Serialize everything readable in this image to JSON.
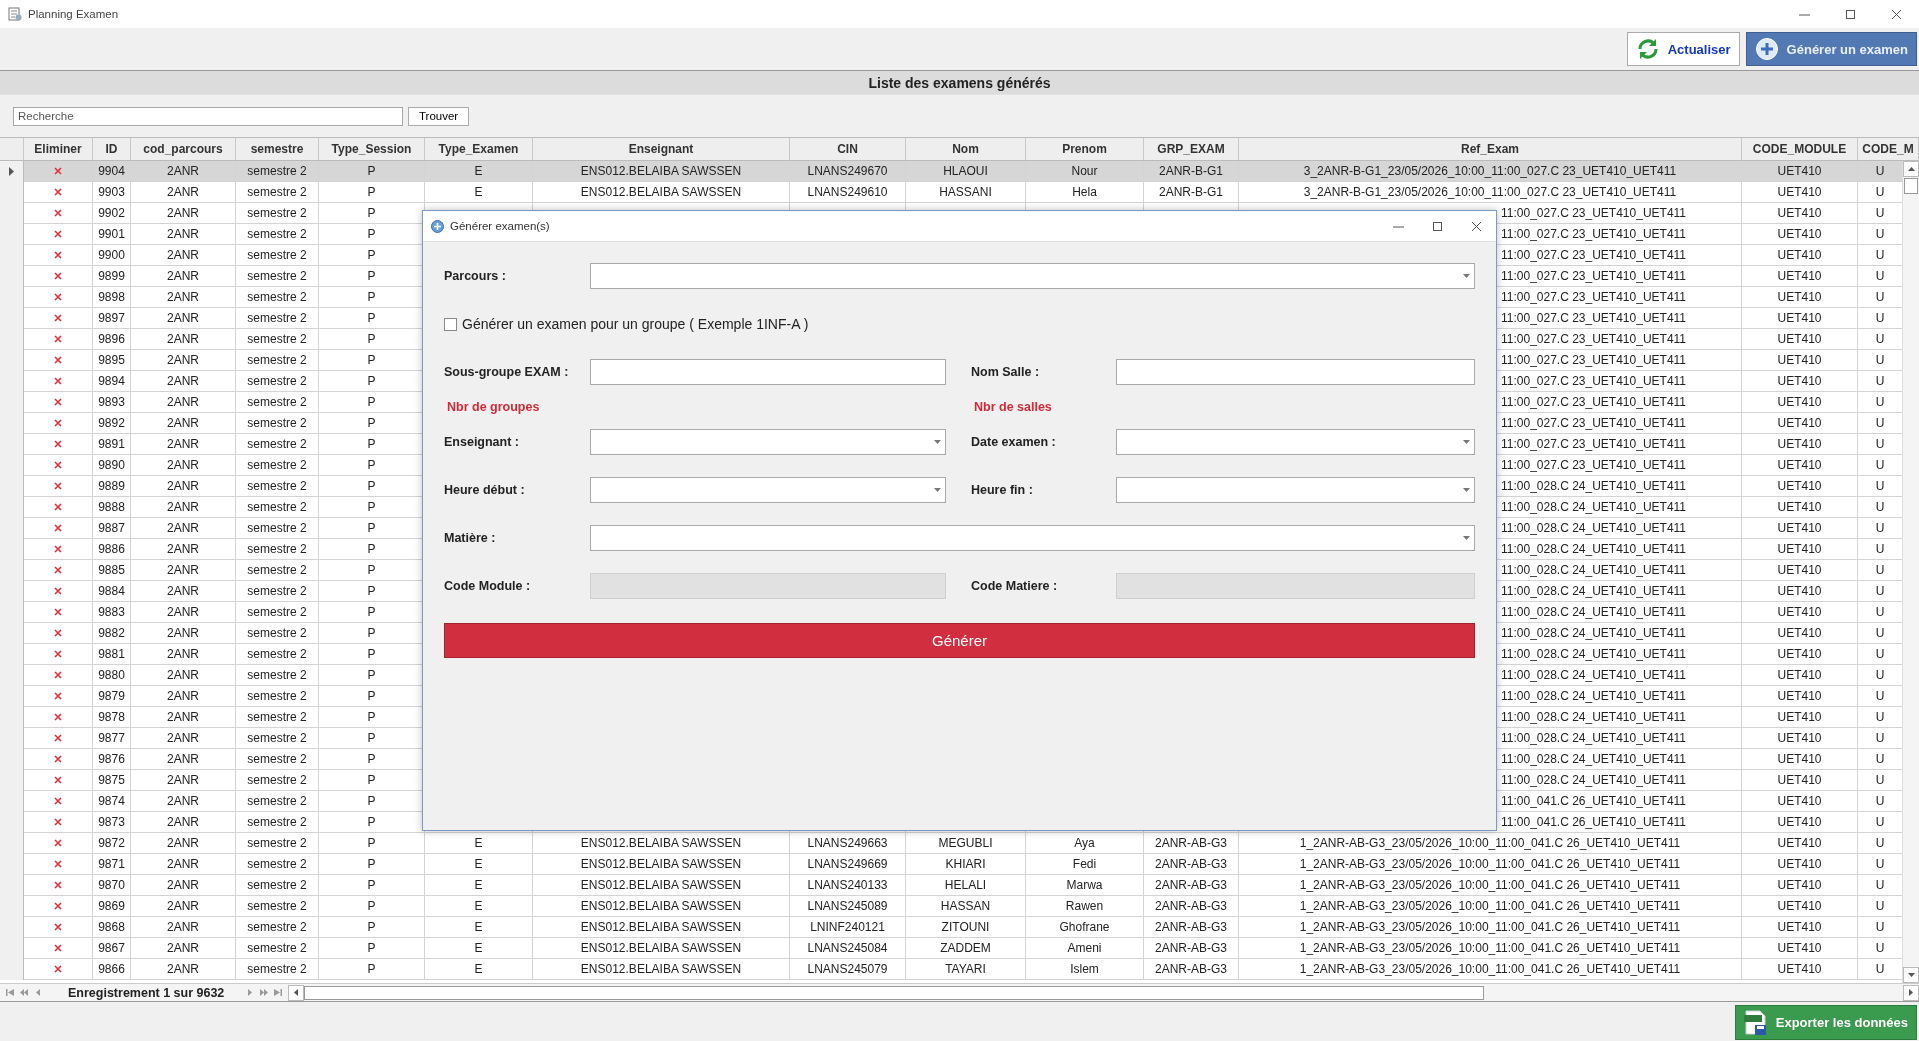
{
  "window": {
    "title": "Planning Examen"
  },
  "toolbar": [
    {
      "label": "Actualiser",
      "kind": "refresh"
    },
    {
      "label": "Générer un examen",
      "kind": "add"
    }
  ],
  "panel_title": "Liste des examens générés",
  "search": {
    "placeholder": "Recherche",
    "button": "Trouver"
  },
  "table": {
    "columns": [
      "Eliminer",
      "ID",
      "cod_parcours",
      "semestre",
      "Type_Session",
      "Type_Examen",
      "Enseignant",
      "CIN",
      "Nom",
      "Prenom",
      "GRP_EXAM",
      "Ref_Exam",
      "CODE_MODULE",
      "CODE_M"
    ],
    "rows": [
      {
        "id": "9904",
        "cod_parcours": "2ANR",
        "semestre": "semestre 2",
        "type_session": "P",
        "type_examen": "E",
        "enseignant": "ENS012.BELAIBA SAWSSEN",
        "cin": "LNANS249670",
        "nom": "HLAOUI",
        "prenom": "Nour",
        "grp_exam": "2ANR-B-G1",
        "ref_exam": "3_2ANR-B-G1_23/05/2026_10:00_11:00_027.C 23_UET410_UET411",
        "code_module": "UET410",
        "code_m": "U",
        "selected": true,
        "covered": false
      },
      {
        "id": "9903",
        "cod_parcours": "2ANR",
        "semestre": "semestre 2",
        "type_session": "P",
        "type_examen": "E",
        "enseignant": "ENS012.BELAIBA SAWSSEN",
        "cin": "LNANS249610",
        "nom": "HASSANI",
        "prenom": "Hela",
        "grp_exam": "2ANR-B-G1",
        "ref_exam": "3_2ANR-B-G1_23/05/2026_10:00_11:00_027.C 23_UET410_UET411",
        "code_module": "UET410",
        "code_m": "U",
        "selected": false,
        "covered": false
      },
      {
        "id": "9902",
        "cod_parcours": "2ANR",
        "semestre": "semestre 2",
        "type_session": "P",
        "ref_exam": "11:00_027.C 23_UET410_UET411",
        "code_module": "UET410",
        "code_m": "U",
        "selected": false,
        "covered": true
      },
      {
        "id": "9901",
        "cod_parcours": "2ANR",
        "semestre": "semestre 2",
        "type_session": "P",
        "ref_exam": "11:00_027.C 23_UET410_UET411",
        "code_module": "UET410",
        "code_m": "U",
        "selected": false,
        "covered": true
      },
      {
        "id": "9900",
        "cod_parcours": "2ANR",
        "semestre": "semestre 2",
        "type_session": "P",
        "ref_exam": "11:00_027.C 23_UET410_UET411",
        "code_module": "UET410",
        "code_m": "U",
        "selected": false,
        "covered": true
      },
      {
        "id": "9899",
        "cod_parcours": "2ANR",
        "semestre": "semestre 2",
        "type_session": "P",
        "ref_exam": "11:00_027.C 23_UET410_UET411",
        "code_module": "UET410",
        "code_m": "U",
        "selected": false,
        "covered": true
      },
      {
        "id": "9898",
        "cod_parcours": "2ANR",
        "semestre": "semestre 2",
        "type_session": "P",
        "ref_exam": "11:00_027.C 23_UET410_UET411",
        "code_module": "UET410",
        "code_m": "U",
        "selected": false,
        "covered": true
      },
      {
        "id": "9897",
        "cod_parcours": "2ANR",
        "semestre": "semestre 2",
        "type_session": "P",
        "ref_exam": "11:00_027.C 23_UET410_UET411",
        "code_module": "UET410",
        "code_m": "U",
        "selected": false,
        "covered": true
      },
      {
        "id": "9896",
        "cod_parcours": "2ANR",
        "semestre": "semestre 2",
        "type_session": "P",
        "ref_exam": "11:00_027.C 23_UET410_UET411",
        "code_module": "UET410",
        "code_m": "U",
        "selected": false,
        "covered": true
      },
      {
        "id": "9895",
        "cod_parcours": "2ANR",
        "semestre": "semestre 2",
        "type_session": "P",
        "ref_exam": "11:00_027.C 23_UET410_UET411",
        "code_module": "UET410",
        "code_m": "U",
        "selected": false,
        "covered": true
      },
      {
        "id": "9894",
        "cod_parcours": "2ANR",
        "semestre": "semestre 2",
        "type_session": "P",
        "ref_exam": "11:00_027.C 23_UET410_UET411",
        "code_module": "UET410",
        "code_m": "U",
        "selected": false,
        "covered": true
      },
      {
        "id": "9893",
        "cod_parcours": "2ANR",
        "semestre": "semestre 2",
        "type_session": "P",
        "ref_exam": "11:00_027.C 23_UET410_UET411",
        "code_module": "UET410",
        "code_m": "U",
        "selected": false,
        "covered": true
      },
      {
        "id": "9892",
        "cod_parcours": "2ANR",
        "semestre": "semestre 2",
        "type_session": "P",
        "ref_exam": "11:00_027.C 23_UET410_UET411",
        "code_module": "UET410",
        "code_m": "U",
        "selected": false,
        "covered": true
      },
      {
        "id": "9891",
        "cod_parcours": "2ANR",
        "semestre": "semestre 2",
        "type_session": "P",
        "ref_exam": "11:00_027.C 23_UET410_UET411",
        "code_module": "UET410",
        "code_m": "U",
        "selected": false,
        "covered": true
      },
      {
        "id": "9890",
        "cod_parcours": "2ANR",
        "semestre": "semestre 2",
        "type_session": "P",
        "ref_exam": "11:00_027.C 23_UET410_UET411",
        "code_module": "UET410",
        "code_m": "U",
        "selected": false,
        "covered": true
      },
      {
        "id": "9889",
        "cod_parcours": "2ANR",
        "semestre": "semestre 2",
        "type_session": "P",
        "ref_exam": "11:00_028.C 24_UET410_UET411",
        "code_module": "UET410",
        "code_m": "U",
        "selected": false,
        "covered": true
      },
      {
        "id": "9888",
        "cod_parcours": "2ANR",
        "semestre": "semestre 2",
        "type_session": "P",
        "ref_exam": "11:00_028.C 24_UET410_UET411",
        "code_module": "UET410",
        "code_m": "U",
        "selected": false,
        "covered": true
      },
      {
        "id": "9887",
        "cod_parcours": "2ANR",
        "semestre": "semestre 2",
        "type_session": "P",
        "ref_exam": "11:00_028.C 24_UET410_UET411",
        "code_module": "UET410",
        "code_m": "U",
        "selected": false,
        "covered": true
      },
      {
        "id": "9886",
        "cod_parcours": "2ANR",
        "semestre": "semestre 2",
        "type_session": "P",
        "ref_exam": "11:00_028.C 24_UET410_UET411",
        "code_module": "UET410",
        "code_m": "U",
        "selected": false,
        "covered": true
      },
      {
        "id": "9885",
        "cod_parcours": "2ANR",
        "semestre": "semestre 2",
        "type_session": "P",
        "ref_exam": "11:00_028.C 24_UET410_UET411",
        "code_module": "UET410",
        "code_m": "U",
        "selected": false,
        "covered": true
      },
      {
        "id": "9884",
        "cod_parcours": "2ANR",
        "semestre": "semestre 2",
        "type_session": "P",
        "ref_exam": "11:00_028.C 24_UET410_UET411",
        "code_module": "UET410",
        "code_m": "U",
        "selected": false,
        "covered": true
      },
      {
        "id": "9883",
        "cod_parcours": "2ANR",
        "semestre": "semestre 2",
        "type_session": "P",
        "ref_exam": "11:00_028.C 24_UET410_UET411",
        "code_module": "UET410",
        "code_m": "U",
        "selected": false,
        "covered": true
      },
      {
        "id": "9882",
        "cod_parcours": "2ANR",
        "semestre": "semestre 2",
        "type_session": "P",
        "ref_exam": "11:00_028.C 24_UET410_UET411",
        "code_module": "UET410",
        "code_m": "U",
        "selected": false,
        "covered": true
      },
      {
        "id": "9881",
        "cod_parcours": "2ANR",
        "semestre": "semestre 2",
        "type_session": "P",
        "ref_exam": "11:00_028.C 24_UET410_UET411",
        "code_module": "UET410",
        "code_m": "U",
        "selected": false,
        "covered": true
      },
      {
        "id": "9880",
        "cod_parcours": "2ANR",
        "semestre": "semestre 2",
        "type_session": "P",
        "ref_exam": "11:00_028.C 24_UET410_UET411",
        "code_module": "UET410",
        "code_m": "U",
        "selected": false,
        "covered": true
      },
      {
        "id": "9879",
        "cod_parcours": "2ANR",
        "semestre": "semestre 2",
        "type_session": "P",
        "ref_exam": "11:00_028.C 24_UET410_UET411",
        "code_module": "UET410",
        "code_m": "U",
        "selected": false,
        "covered": true
      },
      {
        "id": "9878",
        "cod_parcours": "2ANR",
        "semestre": "semestre 2",
        "type_session": "P",
        "ref_exam": "11:00_028.C 24_UET410_UET411",
        "code_module": "UET410",
        "code_m": "U",
        "selected": false,
        "covered": true
      },
      {
        "id": "9877",
        "cod_parcours": "2ANR",
        "semestre": "semestre 2",
        "type_session": "P",
        "ref_exam": "11:00_028.C 24_UET410_UET411",
        "code_module": "UET410",
        "code_m": "U",
        "selected": false,
        "covered": true
      },
      {
        "id": "9876",
        "cod_parcours": "2ANR",
        "semestre": "semestre 2",
        "type_session": "P",
        "ref_exam": "11:00_028.C 24_UET410_UET411",
        "code_module": "UET410",
        "code_m": "U",
        "selected": false,
        "covered": true
      },
      {
        "id": "9875",
        "cod_parcours": "2ANR",
        "semestre": "semestre 2",
        "type_session": "P",
        "ref_exam": "11:00_028.C 24_UET410_UET411",
        "code_module": "UET410",
        "code_m": "U",
        "selected": false,
        "covered": true
      },
      {
        "id": "9874",
        "cod_parcours": "2ANR",
        "semestre": "semestre 2",
        "type_session": "P",
        "ref_exam": "11:00_041.C 26_UET410_UET411",
        "code_module": "UET410",
        "code_m": "U",
        "selected": false,
        "covered": true
      },
      {
        "id": "9873",
        "cod_parcours": "2ANR",
        "semestre": "semestre 2",
        "type_session": "P",
        "ref_exam": "11:00_041.C 26_UET410_UET411",
        "code_module": "UET410",
        "code_m": "U",
        "selected": false,
        "covered": true
      },
      {
        "id": "9872",
        "cod_parcours": "2ANR",
        "semestre": "semestre 2",
        "type_session": "P",
        "type_examen": "E",
        "enseignant": "ENS012.BELAIBA SAWSSEN",
        "cin": "LNANS249663",
        "nom": "MEGUBLI",
        "prenom": "Aya",
        "grp_exam": "2ANR-AB-G3",
        "ref_exam": "1_2ANR-AB-G3_23/05/2026_10:00_11:00_041.C 26_UET410_UET411",
        "code_module": "UET410",
        "code_m": "U",
        "selected": false,
        "covered": false
      },
      {
        "id": "9871",
        "cod_parcours": "2ANR",
        "semestre": "semestre 2",
        "type_session": "P",
        "type_examen": "E",
        "enseignant": "ENS012.BELAIBA SAWSSEN",
        "cin": "LNANS249669",
        "nom": "KHIARI",
        "prenom": "Fedi",
        "grp_exam": "2ANR-AB-G3",
        "ref_exam": "1_2ANR-AB-G3_23/05/2026_10:00_11:00_041.C 26_UET410_UET411",
        "code_module": "UET410",
        "code_m": "U",
        "selected": false,
        "covered": false
      },
      {
        "id": "9870",
        "cod_parcours": "2ANR",
        "semestre": "semestre 2",
        "type_session": "P",
        "type_examen": "E",
        "enseignant": "ENS012.BELAIBA SAWSSEN",
        "cin": "LNANS240133",
        "nom": "HELALI",
        "prenom": "Marwa",
        "grp_exam": "2ANR-AB-G3",
        "ref_exam": "1_2ANR-AB-G3_23/05/2026_10:00_11:00_041.C 26_UET410_UET411",
        "code_module": "UET410",
        "code_m": "U",
        "selected": false,
        "covered": false
      },
      {
        "id": "9869",
        "cod_parcours": "2ANR",
        "semestre": "semestre 2",
        "type_session": "P",
        "type_examen": "E",
        "enseignant": "ENS012.BELAIBA SAWSSEN",
        "cin": "LNANS245089",
        "nom": "HASSAN",
        "prenom": "Rawen",
        "grp_exam": "2ANR-AB-G3",
        "ref_exam": "1_2ANR-AB-G3_23/05/2026_10:00_11:00_041.C 26_UET410_UET411",
        "code_module": "UET410",
        "code_m": "U",
        "selected": false,
        "covered": false
      },
      {
        "id": "9868",
        "cod_parcours": "2ANR",
        "semestre": "semestre 2",
        "type_session": "P",
        "type_examen": "E",
        "enseignant": "ENS012.BELAIBA SAWSSEN",
        "cin": "LNINF240121",
        "nom": "ZITOUNI",
        "prenom": "Ghofrane",
        "grp_exam": "2ANR-AB-G3",
        "ref_exam": "1_2ANR-AB-G3_23/05/2026_10:00_11:00_041.C 26_UET410_UET411",
        "code_module": "UET410",
        "code_m": "U",
        "selected": false,
        "covered": false
      },
      {
        "id": "9867",
        "cod_parcours": "2ANR",
        "semestre": "semestre 2",
        "type_session": "P",
        "type_examen": "E",
        "enseignant": "ENS012.BELAIBA SAWSSEN",
        "cin": "LNANS245084",
        "nom": "ZADDEM",
        "prenom": "Ameni",
        "grp_exam": "2ANR-AB-G3",
        "ref_exam": "1_2ANR-AB-G3_23/05/2026_10:00_11:00_041.C 26_UET410_UET411",
        "code_module": "UET410",
        "code_m": "U",
        "selected": false,
        "covered": false
      },
      {
        "id": "9866",
        "cod_parcours": "2ANR",
        "semestre": "semestre 2",
        "type_session": "P",
        "type_examen": "E",
        "enseignant": "ENS012.BELAIBA SAWSSEN",
        "cin": "LNANS245079",
        "nom": "TAYARI",
        "prenom": "Islem",
        "grp_exam": "2ANR-AB-G3",
        "ref_exam": "1_2ANR-AB-G3_23/05/2026_10:00_11:00_041.C 26_UET410_UET411",
        "code_module": "UET410",
        "code_m": "U",
        "selected": false,
        "covered": false
      }
    ]
  },
  "pager": {
    "text": "Enregistrement 1 sur 9632"
  },
  "export_button": "Exporter les données",
  "dialog": {
    "title": "Générer examen(s)",
    "rows": [
      {
        "kind": "wide",
        "label": "Parcours :",
        "field": {
          "kind": "combo"
        }
      },
      {
        "kind": "checkbox",
        "label": "Générer un examen pour un groupe ( Exemple 1INF-A )",
        "checked": false
      },
      {
        "kind": "pair",
        "left": {
          "label": "Sous-groupe EXAM :",
          "kind": "text"
        },
        "right": {
          "label": "Nom Salle :",
          "kind": "text"
        }
      },
      {
        "kind": "notes",
        "left": "Nbr de groupes",
        "right": "Nbr de salles"
      },
      {
        "kind": "pair",
        "left": {
          "label": "Enseignant :",
          "kind": "combo"
        },
        "right": {
          "label": "Date examen :",
          "kind": "combo"
        }
      },
      {
        "kind": "pair",
        "left": {
          "label": "Heure début :",
          "kind": "combo"
        },
        "right": {
          "label": "Heure fin :",
          "kind": "combo"
        }
      },
      {
        "kind": "wide",
        "label": "Matière :",
        "field": {
          "kind": "combo"
        }
      },
      {
        "kind": "pair",
        "left": {
          "label": "Code Module :",
          "kind": "readonly"
        },
        "right": {
          "label": "Code Matiere :",
          "kind": "readonly"
        }
      }
    ],
    "button": "Générer"
  }
}
